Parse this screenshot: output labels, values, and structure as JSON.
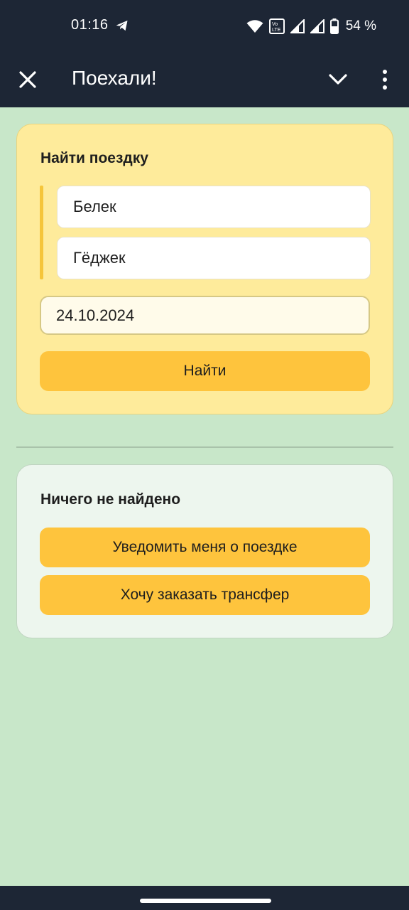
{
  "status_bar": {
    "time": "01:16",
    "battery": "54 %",
    "icons": [
      "telegram-icon",
      "wifi-icon",
      "volte-icon",
      "signal-icon",
      "signal-icon",
      "battery-icon"
    ]
  },
  "toolbar": {
    "title": "Поехали!",
    "icons": [
      "close-icon",
      "chevron-down-icon",
      "more-vert-icon"
    ]
  },
  "search": {
    "heading": "Найти поездку",
    "from": "Белек",
    "to": "Гёджек",
    "date": "24.10.2024",
    "find_label": "Найти"
  },
  "result": {
    "heading": "Ничего не найдено",
    "notify_label": "Уведомить меня о поездке",
    "transfer_label": "Хочу заказать трансфер"
  },
  "colors": {
    "header_bg": "#1d2635",
    "page_bg": "#c8e7c9",
    "card_yellow": "#feeb9b",
    "accent": "#fec43d",
    "card_green": "#edf6ee"
  }
}
